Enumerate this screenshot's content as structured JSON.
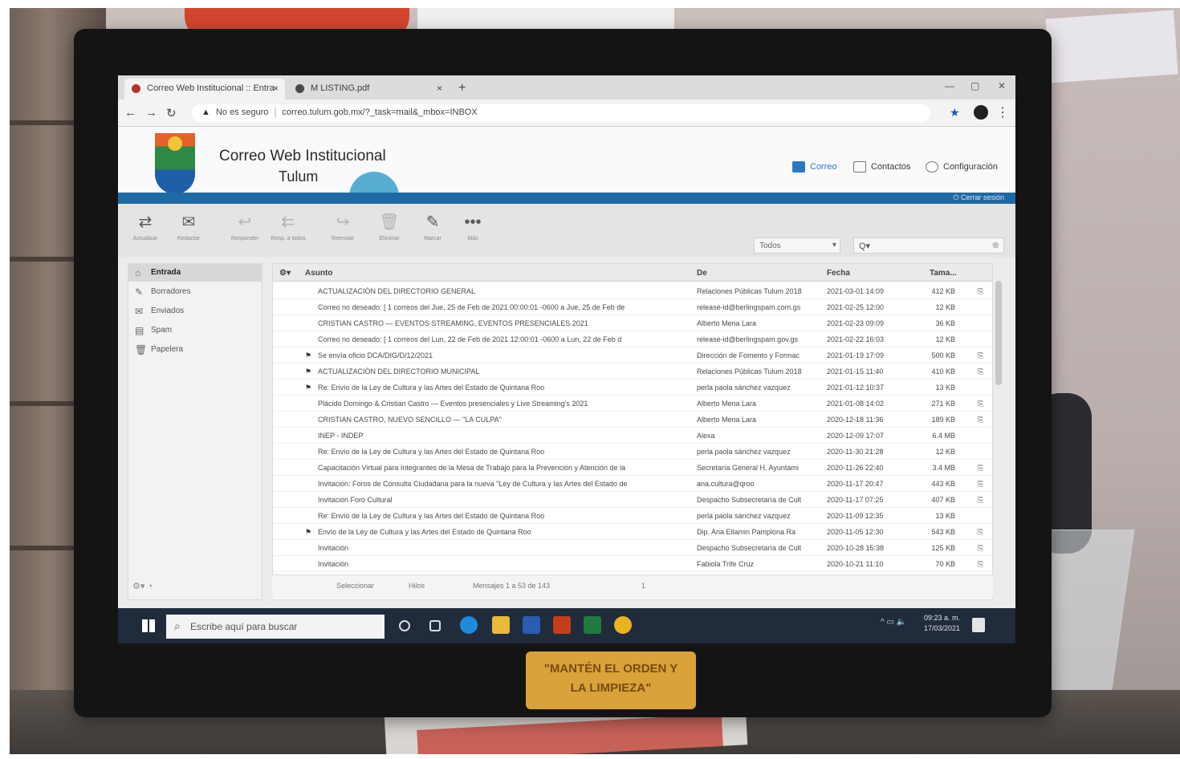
{
  "browser": {
    "tabs": [
      {
        "label": "Correo Web Institucional :: Entra",
        "active": true
      },
      {
        "label": "M LISTING.pdf",
        "active": false
      }
    ],
    "security_label": "No es seguro",
    "url": "correo.tulum.gob.mx/?_task=mail&_mbox=INBOX"
  },
  "webmail": {
    "title": "Correo Web Institucional",
    "subtitle": "Tulum",
    "nav": [
      "Correo",
      "Contactos",
      "Configuración"
    ],
    "logout": "Cerrar sesión",
    "toolbar": [
      "Actualizar",
      "Redactar",
      "Responder",
      "Resp. a todos",
      "Reenviar",
      "Eliminar",
      "Marcar",
      "Más"
    ],
    "filter": "Todos",
    "search_placeholder": "Q▾",
    "folders": [
      "Entrada",
      "Borradores",
      "Enviados",
      "Spam",
      "Papelera"
    ],
    "columns": {
      "subject": "Asunto",
      "from": "De",
      "date": "Fecha",
      "size": "Tama..."
    },
    "messages": [
      {
        "thread": "",
        "subject": "ACTUALIZACIÓN DEL DIRECTORIO GENERAL",
        "from": "Relaciones Públicas Tulum 2018",
        "date": "2021-03-01 14:09",
        "size": "412 KB",
        "clip": true
      },
      {
        "thread": "",
        "subject": "Correo no deseado: [ 1 correos del Jue, 25 de Feb de 2021 00:00:01 -0600 a Jue, 25 de Feb de",
        "from": "release-id@berlingspam.com.gs",
        "date": "2021-02-25 12:00",
        "size": "12 KB",
        "clip": false
      },
      {
        "thread": "",
        "subject": "CRISTIAN CASTRO — EVENTOS STREAMING, EVENTOS PRESENCIALES 2021",
        "from": "Alberto Mena Lara",
        "date": "2021-02-23 09:09",
        "size": "36 KB",
        "clip": false
      },
      {
        "thread": "",
        "subject": "Correo no deseado: [ 1 correos del Lun, 22 de Feb de 2021 12:00:01 -0600 a Lun, 22 de Feb d",
        "from": "release-id@berlingspam.gov.gs",
        "date": "2021-02-22 16:03",
        "size": "12 KB",
        "clip": false
      },
      {
        "thread": "⚑",
        "subject": "Se envía oficio DCA/DIG/D/12/2021",
        "from": "Dirección de Fomento y Formac",
        "date": "2021-01-19 17:09",
        "size": "500 KB",
        "clip": true
      },
      {
        "thread": "⚑",
        "subject": "ACTUALIZACIÓN DEL DIRECTORIO MUNICIPAL",
        "from": "Relaciones Públicas Tulum 2018",
        "date": "2021-01-15 11:40",
        "size": "410 KB",
        "clip": true
      },
      {
        "thread": "⚑",
        "subject": "Re: Envío de la Ley de Cultura y las Artes del Estado de Quintana Roo",
        "from": "perla paola sánchez vazquez",
        "date": "2021-01-12 10:37",
        "size": "13 KB",
        "clip": false
      },
      {
        "thread": "",
        "subject": "Plácido Domingo & Cristian Castro — Eventos presenciales y Live Streaming's 2021",
        "from": "Alberto Mena Lara",
        "date": "2021-01-08 14:02",
        "size": "271 KB",
        "clip": true
      },
      {
        "thread": "",
        "subject": "CRISTIAN CASTRO, NUEVO SENCILLO — \"LA CULPA\"",
        "from": "Alberto Mena Lara",
        "date": "2020-12-18 11:36",
        "size": "189 KB",
        "clip": true
      },
      {
        "thread": "",
        "subject": "INEP - INDEP",
        "from": "Alexa",
        "date": "2020-12-09 17:07",
        "size": "6.4 MB",
        "clip": false
      },
      {
        "thread": "",
        "subject": "Re: Envío de la Ley de Cultura y las Artes del Estado de Quintana Roo",
        "from": "perla paola sánchez vazquez",
        "date": "2020-11-30 21:28",
        "size": "12 KB",
        "clip": false
      },
      {
        "thread": "",
        "subject": "Capacitación Virtual para Integrantes de la Mesa de Trabajo para la Prevención y Atención de la",
        "from": "Secretaría General H. Ayuntami",
        "date": "2020-11-26 22:40",
        "size": "3.4 MB",
        "clip": true
      },
      {
        "thread": "",
        "subject": "Invitación: Foros de Consulta Ciudadana para la nueva \"Ley de Cultura y las Artes del Estado de",
        "from": "ana.cultura@qroo",
        "date": "2020-11-17 20:47",
        "size": "443 KB",
        "clip": true
      },
      {
        "thread": "",
        "subject": "Invitación Foro Cultural",
        "from": "Despacho Subsecretaría de Cult",
        "date": "2020-11-17 07:25",
        "size": "407 KB",
        "clip": true
      },
      {
        "thread": "",
        "subject": "Re: Envío de la Ley de Cultura y las Artes del Estado de Quintana Roo",
        "from": "perla paola sánchez vazquez",
        "date": "2020-11-09 12:35",
        "size": "13 KB",
        "clip": false
      },
      {
        "thread": "⚑",
        "subject": "Envío de la Ley de Cultura y las Artes del Estado de Quintana Roo",
        "from": "Dip. Ana Ellamin Pamplona Ra",
        "date": "2020-11-05 12:30",
        "size": "543 KB",
        "clip": true
      },
      {
        "thread": "",
        "subject": "Invitación",
        "from": "Despacho Subsecretaría de Cult",
        "date": "2020-10-28 15:38",
        "size": "125 KB",
        "clip": true
      },
      {
        "thread": "",
        "subject": "Invitación",
        "from": "Fabiola Trife Cruz",
        "date": "2020-10-21 11:10",
        "size": "70 KB",
        "clip": true
      }
    ],
    "status": {
      "select": "Seleccionar",
      "threads": "Hilos",
      "count": "Mensajes 1 a 53 de 143",
      "page": "1"
    }
  },
  "taskbar": {
    "search_placeholder": "Escribe aquí para buscar",
    "time": "09:23 a. m.",
    "date": "17/03/2021"
  },
  "photo": {
    "sign_line1": "\"MANTÉN EL ORDEN Y",
    "sign_line2": "LA LIMPIEZA\""
  },
  "colors": {
    "accent": "#1e6aa3",
    "taskbar": "#202b3c"
  }
}
